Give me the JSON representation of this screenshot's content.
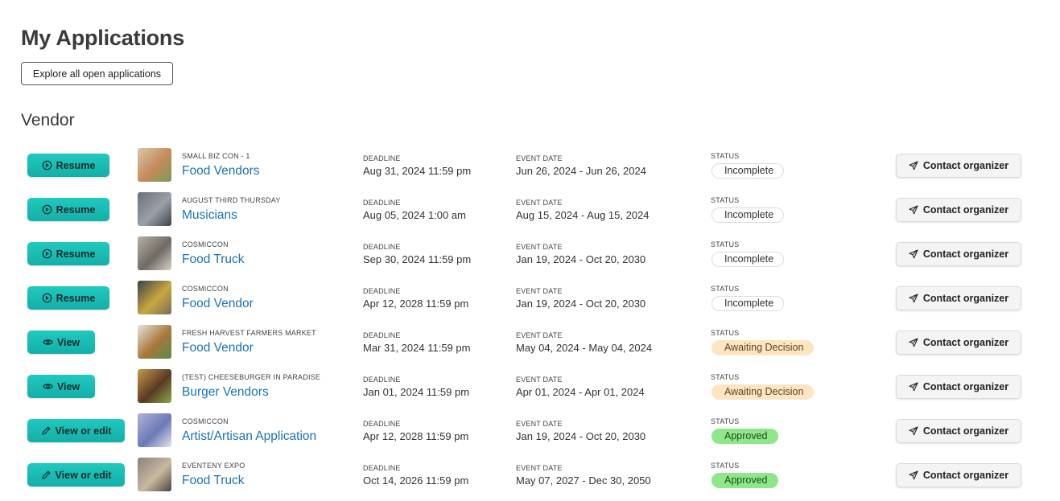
{
  "page": {
    "title": "My Applications",
    "explore_label": "Explore all open applications",
    "section_title": "Vendor"
  },
  "labels": {
    "deadline": "DEADLINE",
    "event_date": "EVENT DATE",
    "status": "STATUS",
    "contact": "Contact organizer"
  },
  "colors": {
    "accent": "#14b8b0",
    "link": "#1a73b8",
    "awaiting_bg": "#fde5c4",
    "approved_bg": "#8ee88a"
  },
  "applications": [
    {
      "action": "Resume",
      "action_icon": "play-circle-icon",
      "thumb_colors": [
        "#d9c7a8",
        "#c48a5a",
        "#7a9a5a"
      ],
      "organization": "SMALL BIZ CON - 1",
      "name": "Food Vendors",
      "deadline": "Aug 31, 2024 11:59 pm",
      "event_date": "Jun 26, 2024 - Jun 26, 2024",
      "status": "Incomplete",
      "status_type": "incomplete"
    },
    {
      "action": "Resume",
      "action_icon": "play-circle-icon",
      "thumb_colors": [
        "#6b6f78",
        "#9aa0a8",
        "#3e4248"
      ],
      "organization": "AUGUST THIRD THURSDAY",
      "name": "Musicians",
      "deadline": "Aug 05, 2024 1:00 am",
      "event_date": "Aug 15, 2024 - Aug 15, 2024",
      "status": "Incomplete",
      "status_type": "incomplete"
    },
    {
      "action": "Resume",
      "action_icon": "play-circle-icon",
      "thumb_colors": [
        "#b8b0a4",
        "#6e6a64",
        "#d8d2c8"
      ],
      "organization": "COSMICCON",
      "name": "Food Truck",
      "deadline": "Sep 30, 2024 11:59 pm",
      "event_date": "Jan 19, 2024 - Oct 20, 2030",
      "status": "Incomplete",
      "status_type": "incomplete"
    },
    {
      "action": "Resume",
      "action_icon": "play-circle-icon",
      "thumb_colors": [
        "#3a3f4a",
        "#c8a840",
        "#7a6a5a"
      ],
      "organization": "COSMICCON",
      "name": "Food Vendor",
      "deadline": "Apr 12, 2028 11:59 pm",
      "event_date": "Jan 19, 2024 - Oct 20, 2030",
      "status": "Incomplete",
      "status_type": "incomplete"
    },
    {
      "action": "View",
      "action_icon": "eye-icon",
      "thumb_colors": [
        "#e8e4dc",
        "#a8783a",
        "#5a8a4a"
      ],
      "organization": "FRESH HARVEST FARMERS MARKET",
      "name": "Food Vendor",
      "deadline": "Mar 31, 2024 11:59 pm",
      "event_date": "May 04, 2024 - May 04, 2024",
      "status": "Awaiting Decision",
      "status_type": "awaiting"
    },
    {
      "action": "View",
      "action_icon": "eye-icon",
      "thumb_colors": [
        "#c89a4a",
        "#5a3a22",
        "#8aa84a"
      ],
      "organization": "(TEST) CHEESEBURGER IN PARADISE",
      "name": "Burger Vendors",
      "deadline": "Jan 01, 2024 11:59 pm",
      "event_date": "Apr 01, 2024 - Apr 01, 2024",
      "status": "Awaiting Decision",
      "status_type": "awaiting"
    },
    {
      "action": "View or edit",
      "action_icon": "pencil-icon",
      "thumb_colors": [
        "#b4b0d8",
        "#6a7ab8",
        "#e8e4f0"
      ],
      "organization": "COSMICCON",
      "name": "Artist/Artisan Application",
      "deadline": "Apr 12, 2028 11:59 pm",
      "event_date": "Jan 19, 2024 - Oct 20, 2030",
      "status": "Approved",
      "status_type": "approved"
    },
    {
      "action": "View or edit",
      "action_icon": "pencil-icon",
      "thumb_colors": [
        "#8a8278",
        "#c8b8a0",
        "#4a4640"
      ],
      "organization": "EVENTENY EXPO",
      "name": "Food Truck",
      "deadline": "Oct 14, 2026 11:59 pm",
      "event_date": "May 07, 2027 - Dec 30, 2050",
      "status": "Approved",
      "status_type": "approved"
    }
  ]
}
